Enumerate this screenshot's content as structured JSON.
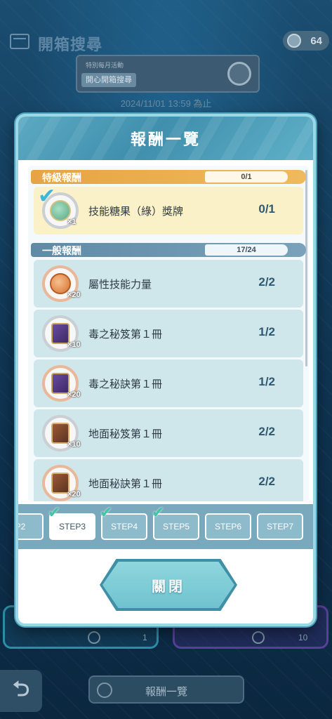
{
  "background": {
    "title": "開箱搜尋",
    "currency_value": "64",
    "banner_small_text": "特別每月活動",
    "banner_main_text": "開心開箱搜尋",
    "date_text": "2024/11/01 13:59 為止",
    "bottom_left_value": "1",
    "bottom_right_value": "10",
    "footer_button_label": "報酬一覽"
  },
  "modal": {
    "title": "報酬一覽",
    "special_section": {
      "label": "特級報酬",
      "count": "0/1"
    },
    "special_rewards": [
      {
        "icon": "gem-medal-icon",
        "name": "技能糖果（綠）獎牌",
        "qty": "×1",
        "progress": "0/1",
        "checked": true
      }
    ],
    "general_section": {
      "label": "一般報酬",
      "count": "17/24"
    },
    "general_rewards": [
      {
        "icon": "medal-icon",
        "name": "屬性技能力量",
        "qty": "×20",
        "progress": "2/2"
      },
      {
        "icon": "book-icon",
        "name": "毒之秘笈第１冊",
        "qty": "×10",
        "progress": "1/2"
      },
      {
        "icon": "book-icon",
        "name": "毒之秘訣第１冊",
        "qty": "×20",
        "progress": "1/2"
      },
      {
        "icon": "book-icon",
        "name": "地面秘笈第１冊",
        "qty": "×10",
        "progress": "2/2"
      },
      {
        "icon": "book-icon",
        "name": "地面秘訣第１冊",
        "qty": "×20",
        "progress": "2/2"
      }
    ],
    "steps": [
      {
        "label": "P2",
        "checked": false,
        "active": false
      },
      {
        "label": "STEP3",
        "checked": true,
        "active": true
      },
      {
        "label": "STEP4",
        "checked": true,
        "active": false
      },
      {
        "label": "STEP5",
        "checked": true,
        "active": false
      },
      {
        "label": "STEP6",
        "checked": false,
        "active": false
      },
      {
        "label": "STEP7",
        "checked": false,
        "active": false
      }
    ],
    "close_label": "關閉"
  },
  "colors": {
    "accent": "#4b9fbb",
    "special": "#e7a443",
    "general": "#5f8aa6",
    "check": "#45c4a5"
  }
}
